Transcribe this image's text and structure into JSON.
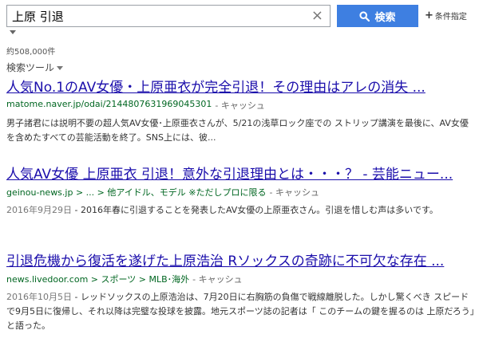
{
  "search": {
    "query": "上原 引退",
    "clear_icon": "×",
    "button_label": "検索",
    "button_color": "#3e7fe1",
    "conditions_label": "条件指定"
  },
  "result_count": "約508,000件",
  "tools_label": "検索ツール",
  "colors": {
    "title": "#1a0dab",
    "url": "#006621"
  },
  "results": [
    {
      "title": "人気No.1のAV女優・上原亜衣が完全引退！その理由はアレの消失 ...",
      "url": "matome.naver.jp/odai/2144807631969045301",
      "cache": "- キャッシュ",
      "date": "",
      "snippet": "男子諸君には説明不要の超人気AV女優･上原亜衣さんが、5/21の浅草ロック座での ストリップ講演を最後に、AV女優を含めたすべての芸能活動を終了。SNS上には、彼..."
    },
    {
      "title": "人気AV女優 上原亜衣 引退！意外な引退理由とは・・・？ - 芸能ニュー...",
      "url": "geinou-news.jp > ... > 他アイドル、モデル ※ただしプロに限る",
      "cache": "- キャッシュ",
      "date": "2016年9月29日",
      "snippet": " - 2016年春に引退することを発表したAV女優の上原亜衣さん。引退を惜しむ声は多いです。"
    },
    {
      "title": "引退危機から復活を遂げた上原浩治 Rソックスの奇跡に不可欠な存在 ...",
      "url": "news.livedoor.com > スポーツ > MLB･海外",
      "cache": "- キャッシュ",
      "date": "2016年10月5日",
      "snippet": " - レッドソックスの上原浩治は、7月20日に右胸筋の負傷で戦線離脱した。しかし驚くべき スピードで9月5日に復帰し、それ以降は完璧な投球を披露。地元スポーツ誌の記者は「 このチームの鍵を握るのは 上原だろう」と語った。"
    }
  ]
}
